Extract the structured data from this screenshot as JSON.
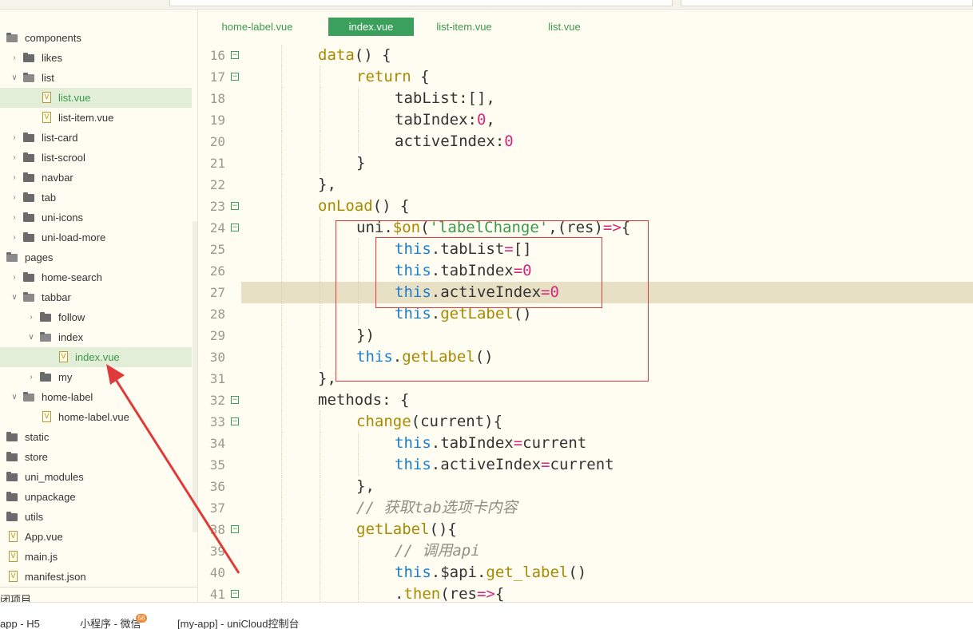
{
  "sidebar": {
    "items": [
      {
        "label": "components",
        "depth": 0,
        "kind": "folder",
        "expanded": true
      },
      {
        "label": "likes",
        "depth": 1,
        "kind": "folder",
        "expanded": false
      },
      {
        "label": "list",
        "depth": 1,
        "kind": "folder",
        "expanded": true
      },
      {
        "label": "list.vue",
        "depth": 2,
        "kind": "file",
        "selected": true
      },
      {
        "label": "list-item.vue",
        "depth": 2,
        "kind": "file"
      },
      {
        "label": "list-card",
        "depth": 1,
        "kind": "folder",
        "expanded": false
      },
      {
        "label": "list-scrool",
        "depth": 1,
        "kind": "folder",
        "expanded": false
      },
      {
        "label": "navbar",
        "depth": 1,
        "kind": "folder",
        "expanded": false
      },
      {
        "label": "tab",
        "depth": 1,
        "kind": "folder",
        "expanded": false
      },
      {
        "label": "uni-icons",
        "depth": 1,
        "kind": "folder",
        "expanded": false
      },
      {
        "label": "uni-load-more",
        "depth": 1,
        "kind": "folder",
        "expanded": false
      },
      {
        "label": "pages",
        "depth": 0,
        "kind": "folder",
        "expanded": true
      },
      {
        "label": "home-search",
        "depth": 1,
        "kind": "folder",
        "expanded": false
      },
      {
        "label": "tabbar",
        "depth": 1,
        "kind": "folder",
        "expanded": true
      },
      {
        "label": "follow",
        "depth": 2,
        "kind": "folder",
        "expanded": false
      },
      {
        "label": "index",
        "depth": 2,
        "kind": "folder",
        "expanded": true
      },
      {
        "label": "index.vue",
        "depth": 3,
        "kind": "file",
        "selected": true
      },
      {
        "label": "my",
        "depth": 2,
        "kind": "folder",
        "expanded": false
      },
      {
        "label": "home-label",
        "depth": 1,
        "kind": "folder",
        "expanded": true
      },
      {
        "label": "home-label.vue",
        "depth": 2,
        "kind": "file"
      },
      {
        "label": "static",
        "depth": 0,
        "kind": "folder",
        "expanded": null
      },
      {
        "label": "store",
        "depth": 0,
        "kind": "folder",
        "expanded": null
      },
      {
        "label": "uni_modules",
        "depth": 0,
        "kind": "folder",
        "expanded": null
      },
      {
        "label": "unpackage",
        "depth": 0,
        "kind": "folder",
        "expanded": null
      },
      {
        "label": "utils",
        "depth": 0,
        "kind": "folder",
        "expanded": null
      },
      {
        "label": "App.vue",
        "depth": 0,
        "kind": "file"
      },
      {
        "label": "main.js",
        "depth": 0,
        "kind": "file"
      },
      {
        "label": "manifest.json",
        "depth": 0,
        "kind": "file"
      }
    ],
    "footer_label": "关闭项目",
    "footer_visible": "闭项目"
  },
  "tabs": [
    {
      "label": "home-label.vue",
      "active": false
    },
    {
      "label": "index.vue",
      "active": true
    },
    {
      "label": "list-item.vue",
      "active": false
    },
    {
      "label": "list.vue",
      "active": false
    }
  ],
  "editor": {
    "highlighted_line": 27,
    "lines": [
      {
        "n": "16",
        "fold": true,
        "indent": 2,
        "tokens": [
          [
            "fn",
            "data"
          ],
          [
            "p",
            "() {"
          ]
        ]
      },
      {
        "n": "17",
        "fold": true,
        "indent": 3,
        "tokens": [
          [
            "fn",
            "return"
          ],
          [
            "p",
            " {"
          ]
        ]
      },
      {
        "n": "18",
        "fold": false,
        "indent": 4,
        "tokens": [
          [
            "p",
            "tabList:[],"
          ]
        ]
      },
      {
        "n": "19",
        "fold": false,
        "indent": 4,
        "tokens": [
          [
            "p",
            "tabIndex:"
          ],
          [
            "num",
            "0"
          ],
          [
            "p",
            ","
          ]
        ]
      },
      {
        "n": "20",
        "fold": false,
        "indent": 4,
        "tokens": [
          [
            "p",
            "activeIndex:"
          ],
          [
            "num",
            "0"
          ]
        ]
      },
      {
        "n": "21",
        "fold": false,
        "indent": 3,
        "tokens": [
          [
            "p",
            "}"
          ]
        ]
      },
      {
        "n": "22",
        "fold": false,
        "indent": 2,
        "tokens": [
          [
            "p",
            "},"
          ]
        ]
      },
      {
        "n": "23",
        "fold": true,
        "indent": 2,
        "tokens": [
          [
            "fn",
            "onLoad"
          ],
          [
            "p",
            "() {"
          ]
        ]
      },
      {
        "n": "24",
        "fold": true,
        "indent": 3,
        "tokens": [
          [
            "p",
            "uni."
          ],
          [
            "fn",
            "$on"
          ],
          [
            "p",
            "("
          ],
          [
            "str",
            "'labelChange'"
          ],
          [
            "p",
            ",(res)"
          ],
          [
            "op",
            "=>"
          ],
          [
            "p",
            "{"
          ]
        ]
      },
      {
        "n": "25",
        "fold": false,
        "indent": 4,
        "tokens": [
          [
            "kw",
            "this"
          ],
          [
            "p",
            ".tabList"
          ],
          [
            "op",
            "="
          ],
          [
            "p",
            "[]"
          ]
        ]
      },
      {
        "n": "26",
        "fold": false,
        "indent": 4,
        "tokens": [
          [
            "kw",
            "this"
          ],
          [
            "p",
            ".tabIndex"
          ],
          [
            "op",
            "="
          ],
          [
            "num",
            "0"
          ]
        ]
      },
      {
        "n": "27",
        "fold": false,
        "indent": 4,
        "tokens": [
          [
            "kw",
            "this"
          ],
          [
            "p",
            ".activeIndex"
          ],
          [
            "op",
            "="
          ],
          [
            "num",
            "0"
          ]
        ]
      },
      {
        "n": "28",
        "fold": false,
        "indent": 4,
        "tokens": [
          [
            "kw",
            "this"
          ],
          [
            "p",
            "."
          ],
          [
            "fn",
            "getLabel"
          ],
          [
            "p",
            "()"
          ]
        ]
      },
      {
        "n": "29",
        "fold": false,
        "indent": 3,
        "tokens": [
          [
            "p",
            "})"
          ]
        ]
      },
      {
        "n": "30",
        "fold": false,
        "indent": 3,
        "tokens": [
          [
            "kw",
            "this"
          ],
          [
            "p",
            "."
          ],
          [
            "fn",
            "getLabel"
          ],
          [
            "p",
            "()"
          ]
        ]
      },
      {
        "n": "31",
        "fold": false,
        "indent": 2,
        "tokens": [
          [
            "p",
            "},"
          ]
        ]
      },
      {
        "n": "32",
        "fold": true,
        "indent": 2,
        "tokens": [
          [
            "p",
            "methods: {"
          ]
        ]
      },
      {
        "n": "33",
        "fold": true,
        "indent": 3,
        "tokens": [
          [
            "fn",
            "change"
          ],
          [
            "p",
            "(current){"
          ]
        ]
      },
      {
        "n": "34",
        "fold": false,
        "indent": 4,
        "tokens": [
          [
            "kw",
            "this"
          ],
          [
            "p",
            ".tabIndex"
          ],
          [
            "op",
            "="
          ],
          [
            "p",
            "current"
          ]
        ]
      },
      {
        "n": "35",
        "fold": false,
        "indent": 4,
        "tokens": [
          [
            "kw",
            "this"
          ],
          [
            "p",
            ".activeIndex"
          ],
          [
            "op",
            "="
          ],
          [
            "p",
            "current"
          ]
        ]
      },
      {
        "n": "36",
        "fold": false,
        "indent": 3,
        "tokens": [
          [
            "p",
            "},"
          ]
        ]
      },
      {
        "n": "37",
        "fold": false,
        "indent": 3,
        "tokens": [
          [
            "cm",
            "// 获取tab选项卡内容"
          ]
        ]
      },
      {
        "n": "38",
        "fold": true,
        "indent": 3,
        "tokens": [
          [
            "fn",
            "getLabel"
          ],
          [
            "p",
            "(){"
          ]
        ]
      },
      {
        "n": "39",
        "fold": false,
        "indent": 4,
        "tokens": [
          [
            "cm",
            "// 调用api"
          ]
        ]
      },
      {
        "n": "40",
        "fold": false,
        "indent": 4,
        "tokens": [
          [
            "kw",
            "this"
          ],
          [
            "p",
            ".$api."
          ],
          [
            "fn",
            "get_label"
          ],
          [
            "p",
            "()"
          ]
        ]
      },
      {
        "n": "41",
        "fold": true,
        "indent": 4,
        "tokens": [
          [
            "p",
            "."
          ],
          [
            "fn",
            "then"
          ],
          [
            "p",
            "(res"
          ],
          [
            "op",
            "=>"
          ],
          [
            "p",
            "{"
          ]
        ]
      }
    ]
  },
  "bottombar": {
    "tabs": [
      {
        "label": "app - H5"
      },
      {
        "label": "小程序 - 微信"
      },
      {
        "label": "[my-app] - uniCloud控制台"
      }
    ],
    "badge": "56"
  },
  "annotation": {
    "color": "#e03a3a"
  }
}
